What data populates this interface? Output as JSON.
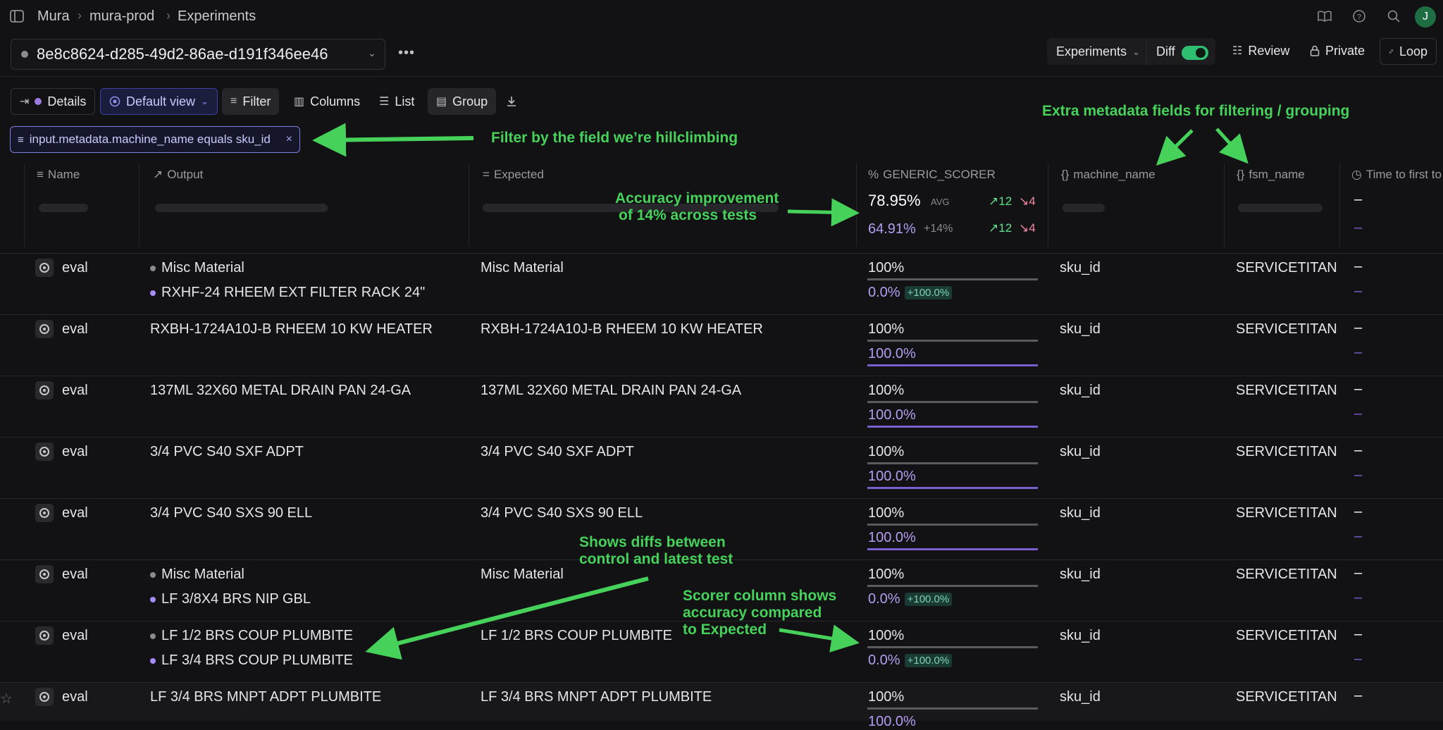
{
  "breadcrumbs": {
    "org": "Mura",
    "project": "mura-prod",
    "page": "Experiments"
  },
  "user_initial": "J",
  "experiment": {
    "id": "8e8c8624-d285-49d2-86ae-d191f346ee46"
  },
  "top_actions": {
    "experiments": "Experiments",
    "diff": "Diff",
    "review": "Review",
    "private": "Private",
    "loop": "Loop"
  },
  "toolbar": {
    "details": "Details",
    "default_view": "Default view",
    "filter": "Filter",
    "columns": "Columns",
    "list": "List",
    "group": "Group"
  },
  "filter_chip": "input.metadata.machine_name equals sku_id",
  "columns": {
    "name": "Name",
    "output": "Output",
    "expected": "Expected",
    "scorer": "GENERIC_SCORER",
    "machine_name": "machine_name",
    "fsm_name": "fsm_name",
    "time": "Time to first to"
  },
  "summary": {
    "avg_value": "78.95%",
    "avg_label": "AVG",
    "avg_up": "12",
    "avg_down": "4",
    "cmp_value": "64.91%",
    "cmp_delta": "+14%",
    "cmp_up": "12",
    "cmp_down": "4",
    "time_dash": "–",
    "time_dash2": "–"
  },
  "rows": [
    {
      "name": "eval",
      "out1": "Misc Material",
      "out2": "RXHF-24 RHEEM EXT FILTER RACK 24\"",
      "expected": "Misc Material",
      "score": "100%",
      "score2": "0.0%",
      "delta": "+100.0%",
      "machine": "sku_id",
      "fsm": "SERVICETITAN",
      "t1": "–",
      "t2": "–"
    },
    {
      "name": "eval",
      "out1": "RXBH-1724A10J-B RHEEM 10 KW HEATER",
      "expected": "RXBH-1724A10J-B RHEEM 10 KW HEATER",
      "score": "100%",
      "score2": "100.0%",
      "machine": "sku_id",
      "fsm": "SERVICETITAN",
      "t1": "–",
      "t2": "–"
    },
    {
      "name": "eval",
      "out1": "137ML 32X60 METAL DRAIN PAN 24-GA",
      "expected": "137ML 32X60 METAL DRAIN PAN 24-GA",
      "score": "100%",
      "score2": "100.0%",
      "machine": "sku_id",
      "fsm": "SERVICETITAN",
      "t1": "–",
      "t2": "–"
    },
    {
      "name": "eval",
      "out1": "3/4 PVC S40 SXF ADPT",
      "expected": "3/4 PVC S40 SXF ADPT",
      "score": "100%",
      "score2": "100.0%",
      "machine": "sku_id",
      "fsm": "SERVICETITAN",
      "t1": "–",
      "t2": "–"
    },
    {
      "name": "eval",
      "out1": "3/4 PVC S40 SXS 90 ELL",
      "expected": "3/4 PVC S40 SXS 90 ELL",
      "score": "100%",
      "score2": "100.0%",
      "machine": "sku_id",
      "fsm": "SERVICETITAN",
      "t1": "–",
      "t2": "–"
    },
    {
      "name": "eval",
      "out1": "Misc Material",
      "out2": "LF 3/8X4 BRS NIP GBL",
      "expected": "Misc Material",
      "score": "100%",
      "score2": "0.0%",
      "delta": "+100.0%",
      "machine": "sku_id",
      "fsm": "SERVICETITAN",
      "t1": "–",
      "t2": "–"
    },
    {
      "name": "eval",
      "out1": "LF 1/2 BRS COUP PLUMBITE",
      "out2": "LF 3/4 BRS COUP PLUMBITE",
      "expected": "LF 1/2 BRS COUP PLUMBITE",
      "score": "100%",
      "score2": "0.0%",
      "delta": "+100.0%",
      "machine": "sku_id",
      "fsm": "SERVICETITAN",
      "t1": "–",
      "t2": "–"
    },
    {
      "name": "eval",
      "out1": "LF 3/4 BRS MNPT ADPT PLUMBITE",
      "expected": "LF 3/4 BRS MNPT ADPT PLUMBITE",
      "score": "100%",
      "score2": "100.0%",
      "machine": "sku_id",
      "fsm": "SERVICETITAN",
      "t1": "–",
      "t2": ""
    }
  ],
  "annotations": {
    "filter": "Filter by the field we’re hillclimbing",
    "metadata": "Extra metadata fields for filtering / grouping",
    "accuracy1": "Accuracy improvement",
    "accuracy2": "of 14% across tests",
    "diffs1": "Shows diffs between",
    "diffs2": "control and latest test",
    "scorer1": "Scorer column shows",
    "scorer2": "accuracy compared",
    "scorer3": "to Expected"
  },
  "colors": {
    "accent": "#7c7fe0",
    "toggle": "#2fbf71",
    "annotation": "#46d25a",
    "compare": "#b39df0"
  }
}
